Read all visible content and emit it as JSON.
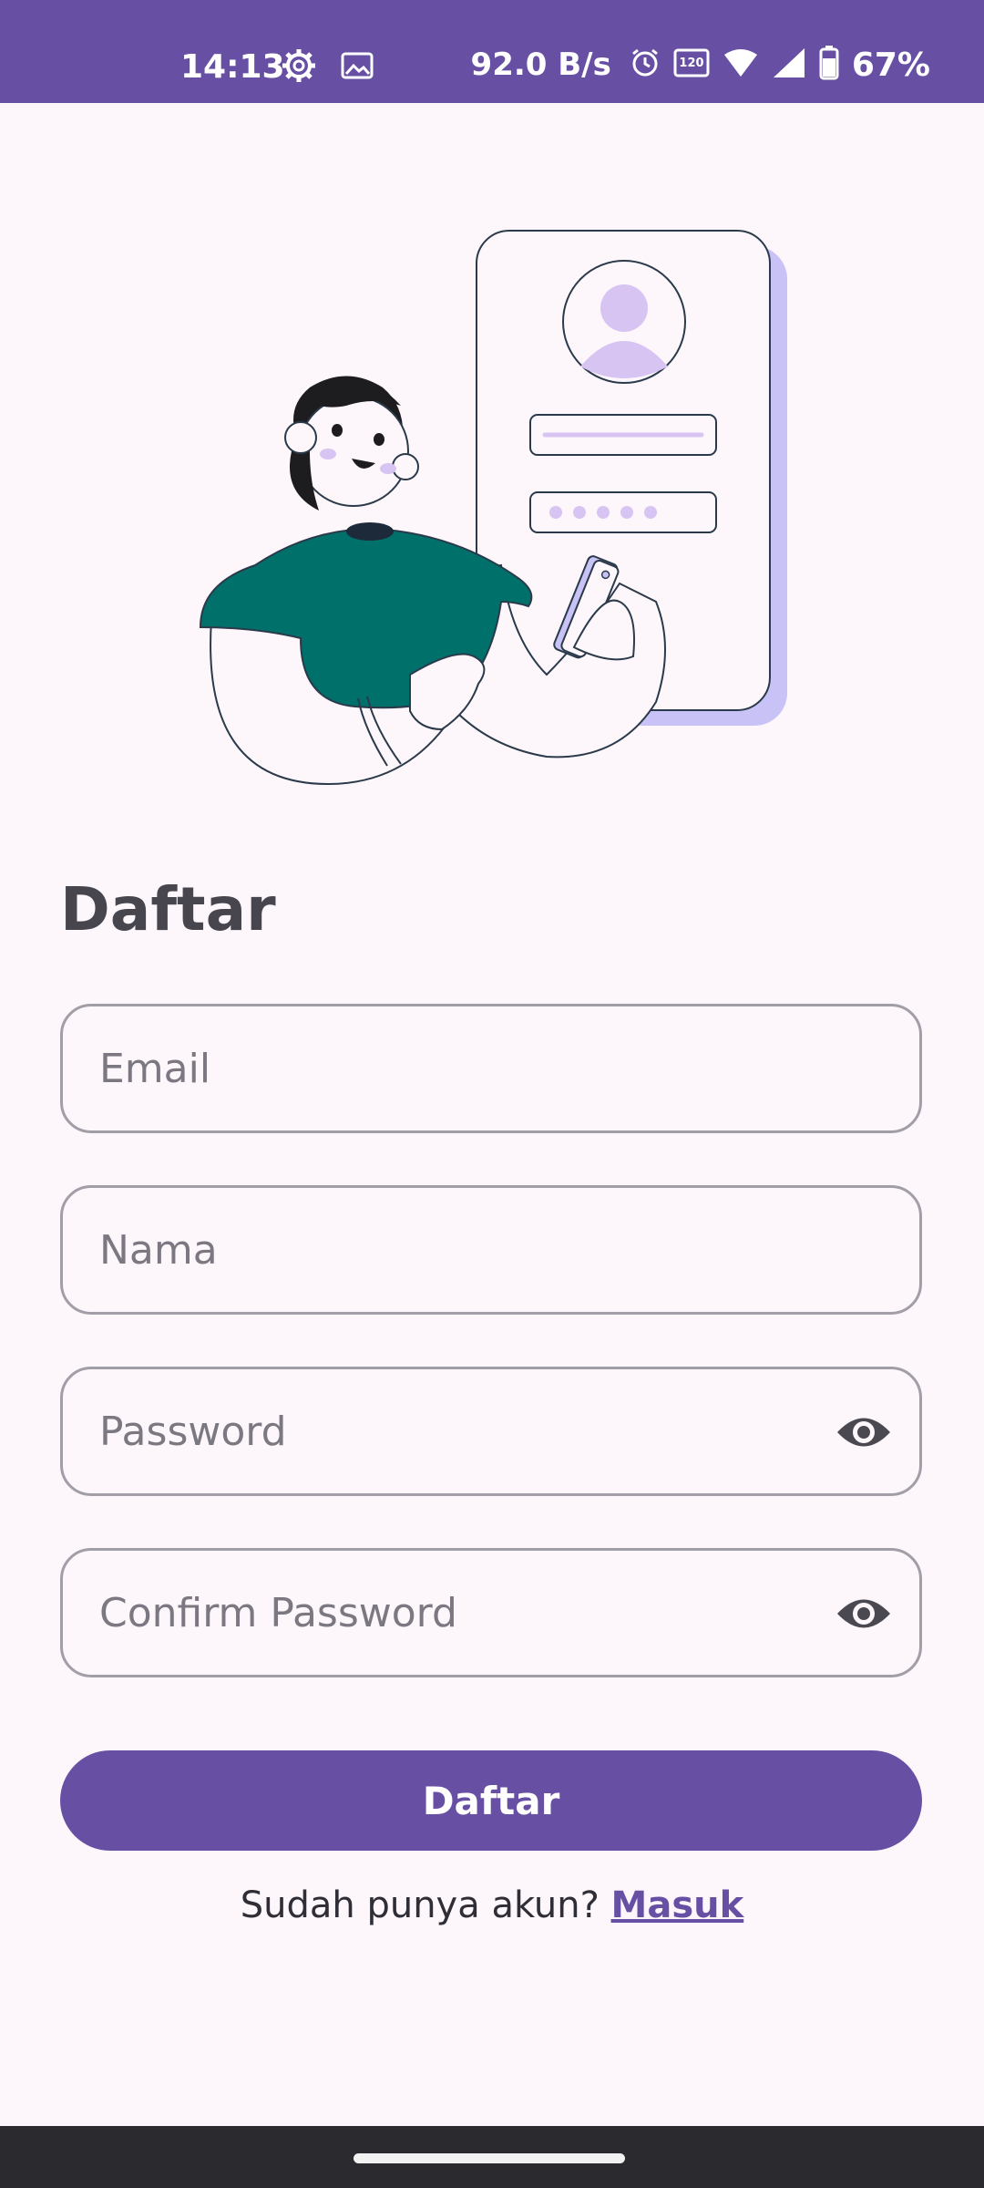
{
  "status_bar": {
    "time": "14:13",
    "net_speed": "92.0 B/s",
    "battery": "67%",
    "icons": [
      "settings-gear-icon",
      "image-icon",
      "alarm-icon",
      "refresh-rate-120hz-icon",
      "wifi-icon",
      "cell-signal-icon",
      "battery-icon"
    ]
  },
  "screen": {
    "title": "Daftar",
    "fields": {
      "email_placeholder": "Email",
      "name_placeholder": "Nama",
      "password_placeholder": "Password",
      "confirm_password_placeholder": "Confirm Password"
    },
    "submit_label": "Daftar",
    "footer_prompt": "Sudah punya akun?",
    "login_link": "Masuk"
  },
  "colors": {
    "primary": "#6750a4",
    "background": "#fdf7fc",
    "outline": "#a29ea8",
    "text_dark": "#47454d",
    "illustration_accent": "#c8c2f6",
    "illustration_shirt": "#00706b"
  }
}
